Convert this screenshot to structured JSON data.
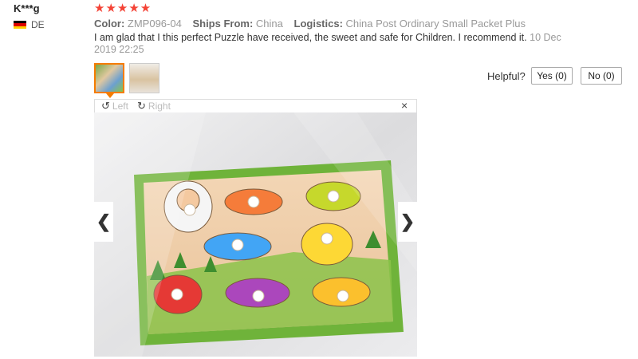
{
  "review": {
    "user": "K***g",
    "country": "DE",
    "stars": "★★★★★",
    "color_label": "Color:",
    "color_value": "ZMP096-04",
    "ships_label": "Ships From:",
    "ships_value": "China",
    "logistics_label": "Logistics:",
    "logistics_value": "China Post Ordinary Small Packet Plus",
    "text": "I am glad that I this perfect Puzzle have received, the sweet and safe for Children. I recommend it.",
    "date": "10 Dec 2019 22:25"
  },
  "helpful": {
    "label": "Helpful?",
    "yes": "Yes (0)",
    "no": "No (0)"
  },
  "viewer": {
    "rotate_left": "Left",
    "rotate_right": "Right",
    "close": "×",
    "prev": "❮",
    "next": "❯"
  },
  "colors": {
    "star": "#f44336",
    "selected_thumb_border": "#f57c00"
  }
}
